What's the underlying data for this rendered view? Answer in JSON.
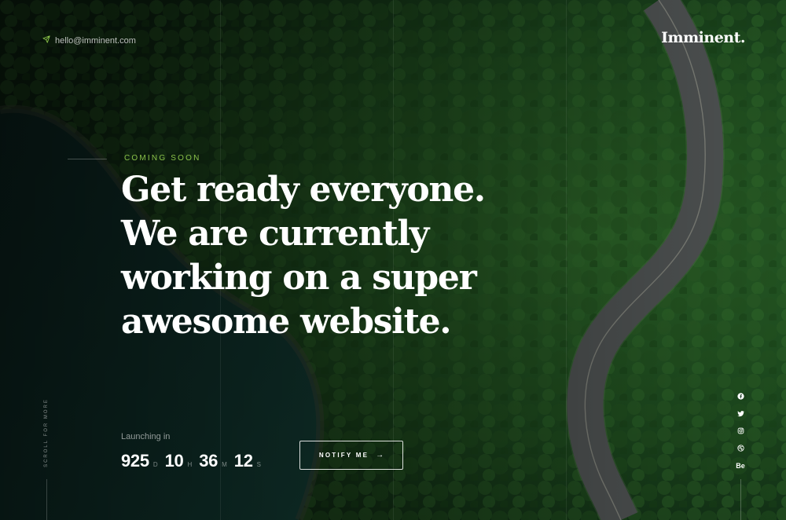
{
  "header": {
    "email": "hello@imminent.com",
    "email_icon": "paper-plane-icon",
    "logo": "Imminent."
  },
  "hero": {
    "eyebrow": "COMING SOON",
    "headline_lines": [
      "Get ready everyone.",
      "We are currently",
      "working on a super",
      "awesome website."
    ]
  },
  "launch": {
    "label": "Launching in",
    "days": "925",
    "days_suffix": "D",
    "hours": "10",
    "hours_suffix": "H",
    "minutes": "36",
    "minutes_suffix": "M",
    "seconds": "12",
    "seconds_suffix": "S"
  },
  "notify_button": {
    "label": "NOTIFY ME",
    "arrow": "→"
  },
  "scroll_hint": "SCROLL FOR MORE",
  "social": [
    {
      "icon": "facebook-icon"
    },
    {
      "icon": "twitter-icon"
    },
    {
      "icon": "instagram-icon"
    },
    {
      "icon": "dribbble-icon"
    },
    {
      "icon": "behance-icon",
      "text": "Be"
    }
  ],
  "colors": {
    "accent": "#8bc34a",
    "text": "#ffffff",
    "forest": "#1f4a22",
    "water": "#123a33"
  }
}
